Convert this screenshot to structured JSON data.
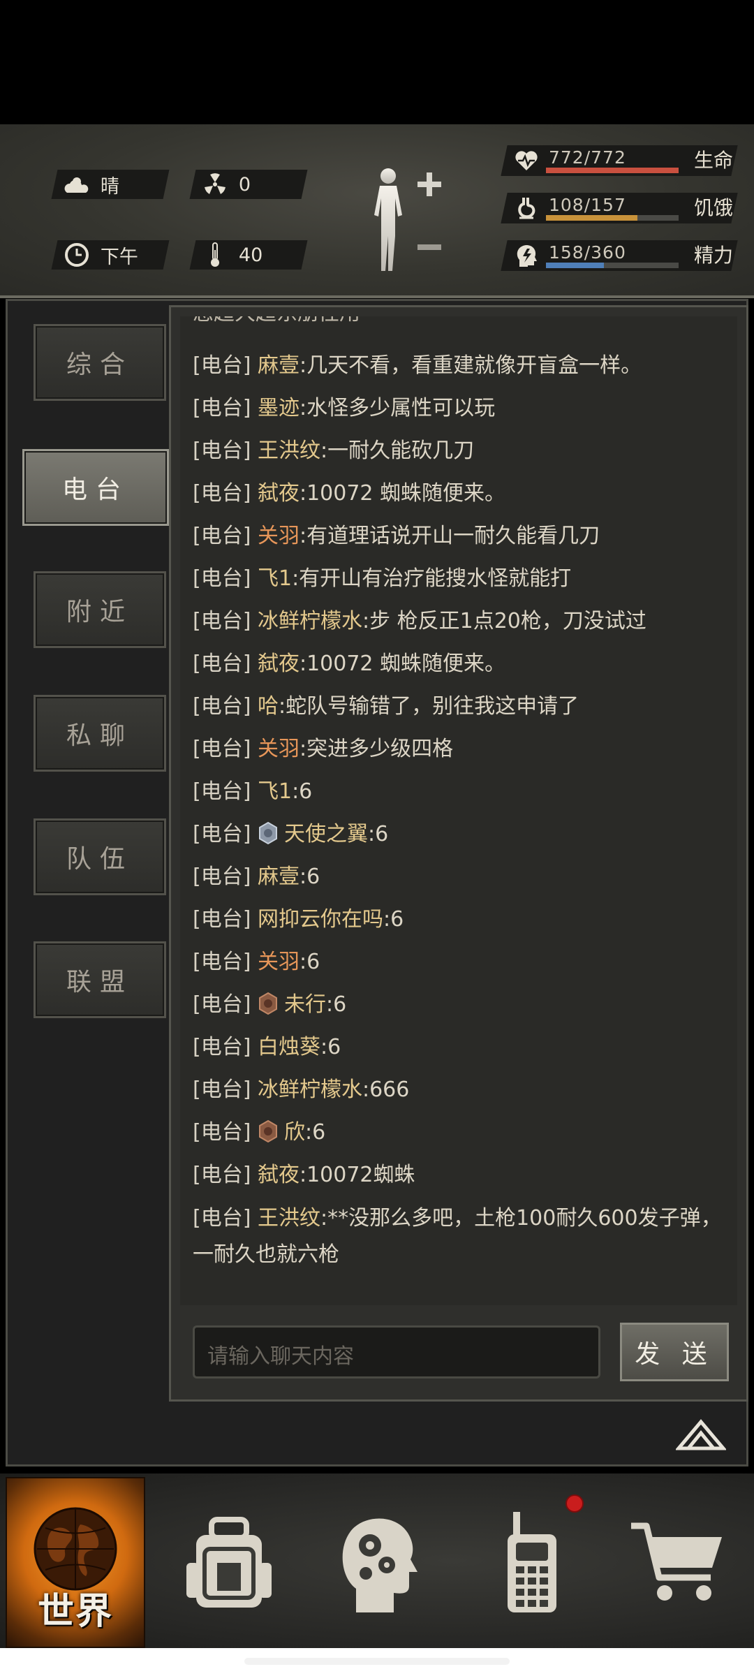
{
  "status": {
    "weather": "晴",
    "radiation": "0",
    "time_of_day": "下午",
    "temperature": "40"
  },
  "stats": {
    "health": {
      "value": "772/772",
      "label": "生命",
      "fraction": 1.0,
      "color": "#c9503f"
    },
    "hunger": {
      "value": "108/157",
      "label": "饥饿",
      "fraction": 0.688,
      "color": "#c8923a"
    },
    "energy": {
      "value": "158/360",
      "label": "精力",
      "fraction": 0.439,
      "color": "#4f7fb8"
    }
  },
  "tabs": [
    {
      "label": "综合",
      "active": false
    },
    {
      "label": "电台",
      "active": true
    },
    {
      "label": "附近",
      "active": false
    },
    {
      "label": "私聊",
      "active": false
    },
    {
      "label": "队伍",
      "active": false
    },
    {
      "label": "联盟",
      "active": false
    }
  ],
  "chat": {
    "cut_off_text": "您超大超东朋性用",
    "channel": "[电台]",
    "messages": [
      {
        "name": "麻壹",
        "text": ":几天不看，看重建就像开盲盒一样。"
      },
      {
        "name": "墨迹",
        "text": ":水怪多少属性可以玩"
      },
      {
        "name": "王洪纹",
        "text": ":一耐久能砍几刀"
      },
      {
        "name": "弑夜",
        "text": ":10072 蜘蛛随便来。"
      },
      {
        "name": "关羽",
        "text": ":有道理话说开山一耐久能看几刀"
      },
      {
        "name": "飞1",
        "text": ":有开山有治疗能搜水怪就能打"
      },
      {
        "name": "冰鲜柠檬水",
        "text": ":步 枪反正1点20枪，刀没试过"
      },
      {
        "name": "弑夜",
        "text": ":10072 蜘蛛随便来。"
      },
      {
        "name": "哈",
        "text": ":蛇队号输错了，别往我这申请了"
      },
      {
        "name": "关羽",
        "text": ":突进多少级四格"
      },
      {
        "name": "飞1",
        "text": ":6"
      },
      {
        "name": "天使之翼",
        "text": ":6"
      },
      {
        "name": "麻壹",
        "text": ":6"
      },
      {
        "name": "网抑云你在吗",
        "text": ":6"
      },
      {
        "name": "关羽",
        "text": ":6"
      },
      {
        "name": "未行",
        "text": ":6"
      },
      {
        "name": "白烛葵",
        "text": ":6"
      },
      {
        "name": "冰鲜柠檬水",
        "text": ":666"
      },
      {
        "name": "欣",
        "text": ":6"
      },
      {
        "name": "弑夜",
        "text": ":10072蜘蛛"
      },
      {
        "name": "王洪纹",
        "text": ":**没那么多吧，土枪100耐久600发子弹，一耐久也就六枪"
      }
    ],
    "input_placeholder": "请输入聊天内容",
    "send_label": "发 送"
  },
  "nav": {
    "world_label": "世界",
    "items": [
      "backpack-icon",
      "skills-head-icon",
      "radio-phone-icon",
      "shop-cart-icon"
    ]
  }
}
